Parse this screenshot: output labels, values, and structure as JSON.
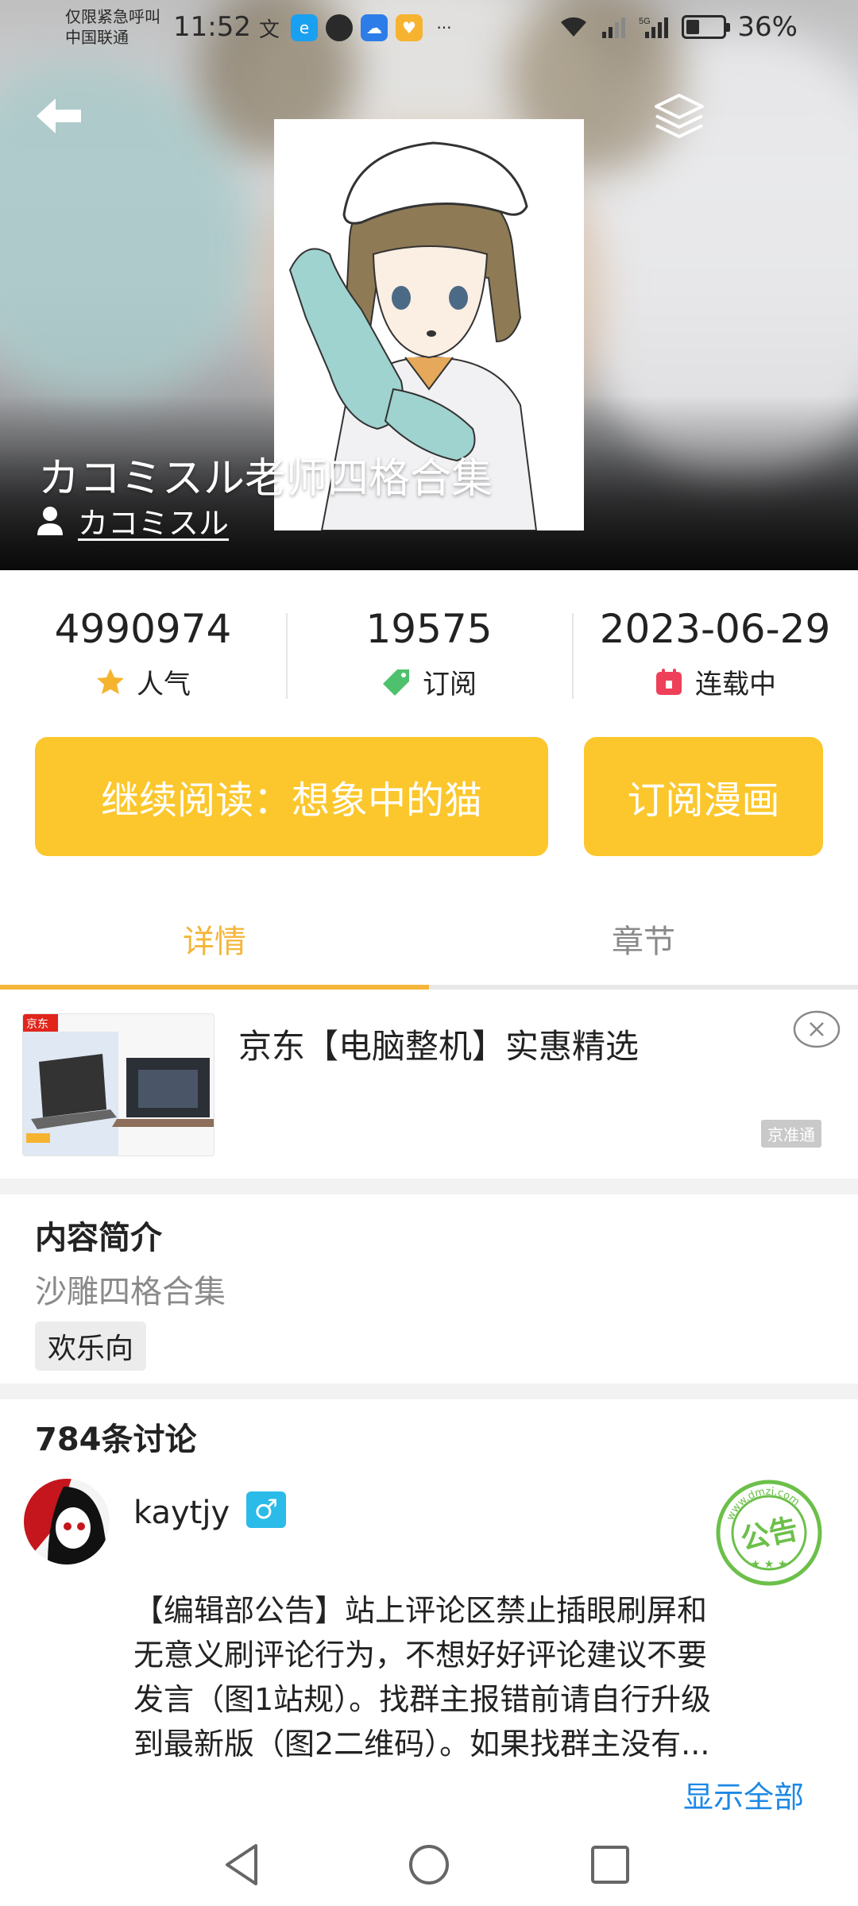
{
  "status_bar": {
    "carrier_line1": "仅限紧急呼叫",
    "carrier_line2": "中国联通",
    "time": "11:52",
    "battery_percent": "36%",
    "battery_level": 0.36
  },
  "hero": {
    "title": "カコミスル老师四格合集",
    "author": "カコミスル"
  },
  "stats": [
    {
      "value": "4990974",
      "label": "人气",
      "icon": "star-icon",
      "color": "#f6b330"
    },
    {
      "value": "19575",
      "label": "订阅",
      "icon": "tag-icon",
      "color": "#4fc06d"
    },
    {
      "value": "2023-06-29",
      "label": "连载中",
      "icon": "calendar-icon",
      "color": "#ee4058"
    }
  ],
  "actions": {
    "continue_label": "继续阅读：想象中的猫",
    "subscribe_label": "订阅漫画"
  },
  "tabs": [
    {
      "label": "详情",
      "active": true
    },
    {
      "label": "章节",
      "active": false
    }
  ],
  "ad": {
    "title": "京东【电脑整机】实惠精选",
    "badge": "京东",
    "source": "京准通"
  },
  "intro": {
    "heading": "内容简介",
    "text": "沙雕四格合集",
    "tags": [
      "欢乐向"
    ]
  },
  "discussion": {
    "heading": "784条讨论",
    "comment": {
      "user": "kaytjy",
      "gender_symbol": "♂",
      "stamp_text": "公告",
      "stamp_ring_text": "www.dmzj.com",
      "lines": [
        "【编辑部公告】站上评论区禁止插眼刷屏和",
        "无意义刷评论行为，不想好好评论建议不要",
        "发言（图1站规）。找群主报错前请自行升级",
        "到最新版（图2二维码）。如果找群主没有..."
      ],
      "show_all": "显示全部"
    }
  },
  "colors": {
    "accent": "#fcc72c",
    "tab_active": "#f4b63a",
    "link": "#1e88e5"
  }
}
